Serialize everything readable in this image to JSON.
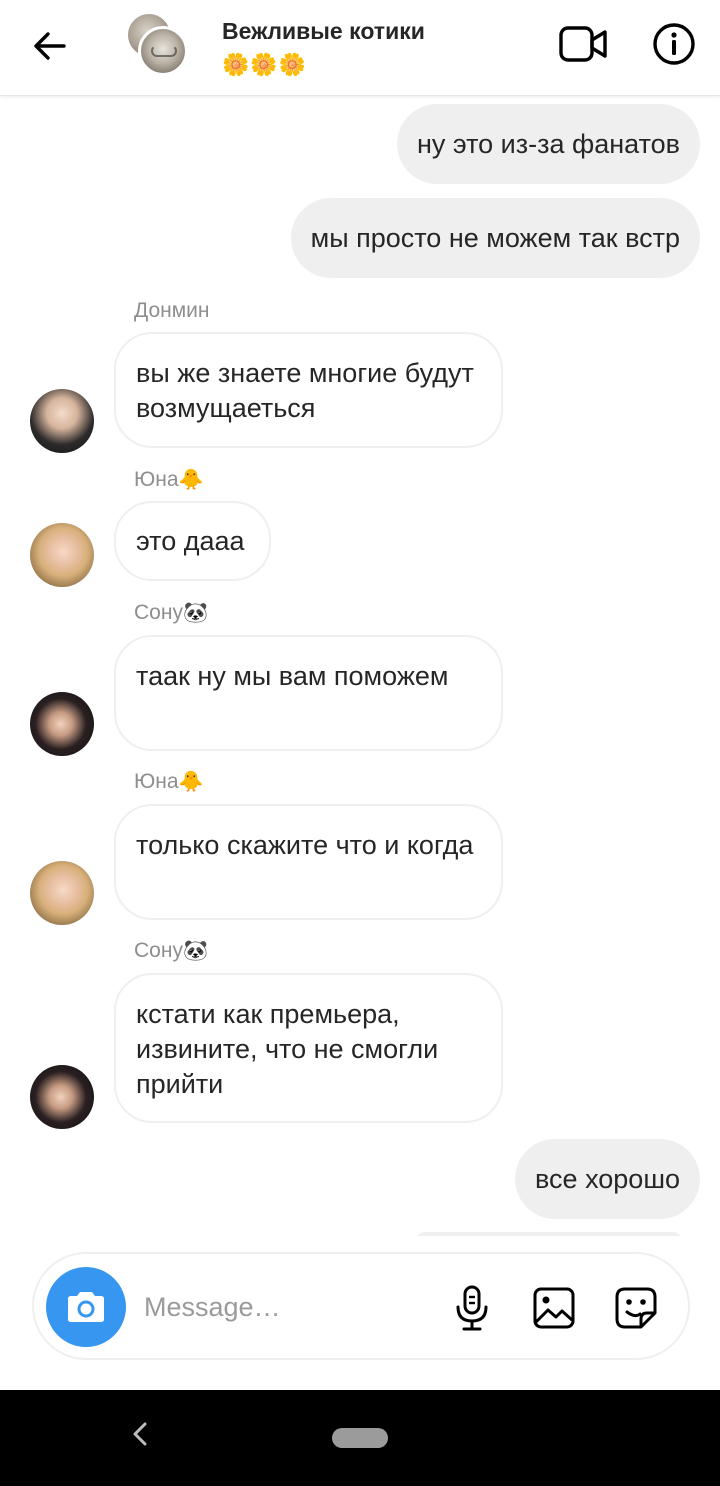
{
  "header": {
    "title": "Вежливые котики",
    "subtitle": "🌼🌼🌼",
    "back_icon": "arrow-left-icon",
    "video_icon": "video-camera-icon",
    "info_icon": "info-circle-icon"
  },
  "messages": [
    {
      "type": "outgoing",
      "text": "ну это из-за фанатов"
    },
    {
      "type": "outgoing",
      "text": "мы просто не можем так встр"
    },
    {
      "type": "incoming",
      "sender": "Донмин",
      "sender_emoji": "",
      "text": "вы же знаете многие будут возмущаеться"
    },
    {
      "type": "incoming",
      "sender": "Юна",
      "sender_emoji": "🐥",
      "text": "это дааа"
    },
    {
      "type": "incoming",
      "sender": "Сону",
      "sender_emoji": "🐼",
      "text": "таак ну мы вам поможем"
    },
    {
      "type": "incoming",
      "sender": "Юна",
      "sender_emoji": "🐥",
      "text": "только скажите что и когда"
    },
    {
      "type": "incoming",
      "sender": "Сону",
      "sender_emoji": "🐼",
      "text": "кстати как премьера, извините, что не смогли прийти"
    },
    {
      "type": "outgoing",
      "text": "все хорошо"
    }
  ],
  "composer": {
    "placeholder": "Message…",
    "camera_icon": "camera-icon",
    "mic_icon": "microphone-icon",
    "gallery_icon": "image-icon",
    "sticker_icon": "sticker-icon"
  },
  "colors": {
    "accent": "#3797f0",
    "outgoing_bubble": "#efefef",
    "incoming_border": "#efefef",
    "sender_text": "#8e8e8e"
  }
}
